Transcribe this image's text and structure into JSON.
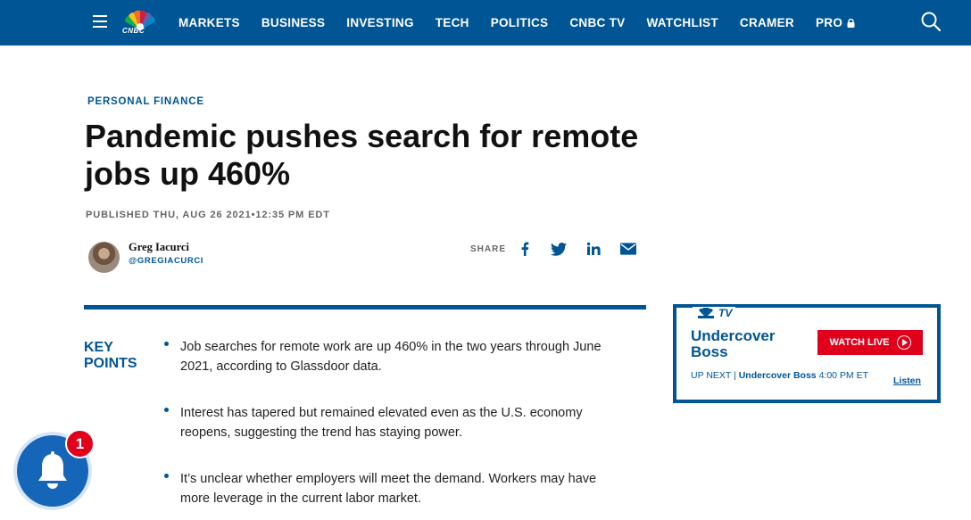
{
  "nav": {
    "logo_text": "CNBC",
    "items": [
      "MARKETS",
      "BUSINESS",
      "INVESTING",
      "TECH",
      "POLITICS",
      "CNBC TV",
      "WATCHLIST",
      "CRAMER",
      "PRO"
    ]
  },
  "article": {
    "section": "PERSONAL FINANCE",
    "headline": "Pandemic pushes search for remote jobs up 460%",
    "published": "PUBLISHED THU, AUG 26 2021•12:35 PM EDT",
    "author_name": "Greg Iacurci",
    "author_handle": "@GREGIACURCI",
    "share_label": "SHARE",
    "key_points_title": "KEY POINTS",
    "key_points": [
      "Job searches for remote work are up 460% in the two years through June 2021, according to Glassdoor data.",
      "Interest has tapered but remained elevated even as the U.S. economy reopens, suggesting the trend has staying power.",
      "It’s unclear whether employers will meet the demand. Workers may have more leverage in the current labor market."
    ]
  },
  "tv_widget": {
    "logo_text": "TV",
    "show_title": "Undercover Boss",
    "watch_live": "WATCH LIVE",
    "up_next_label": "UP NEXT |",
    "up_next_show": "Undercover Boss",
    "up_next_time": "4:00 PM ET",
    "listen": "Listen"
  },
  "notification": {
    "count": "1"
  },
  "colors": {
    "brand_blue": "#005594",
    "accent_red": "#e0001b"
  }
}
